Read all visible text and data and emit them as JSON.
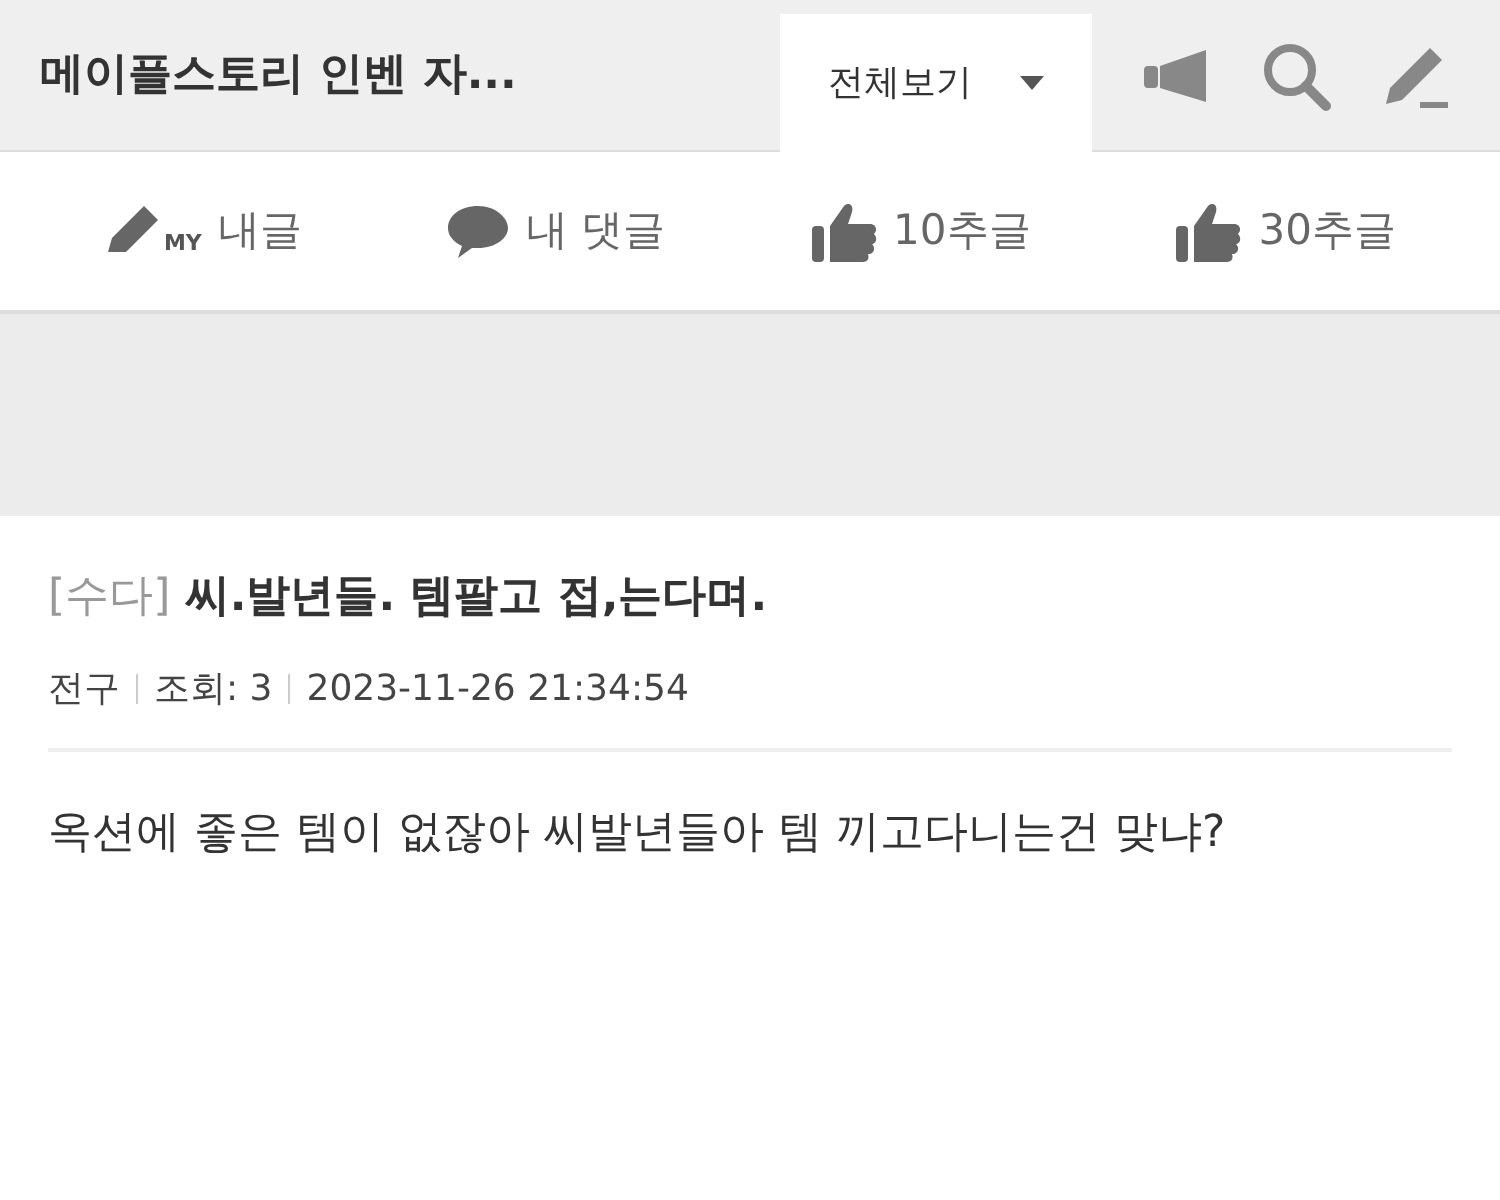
{
  "header": {
    "title": "메이플스토리 인벤 자...",
    "dropdown": "전체보기"
  },
  "nav": [
    {
      "kind": "my",
      "label": "내글",
      "badge": "MY"
    },
    {
      "kind": "comment",
      "label": "내 댓글"
    },
    {
      "kind": "thumb",
      "label": "10추글"
    },
    {
      "kind": "thumb",
      "label": "30추글"
    }
  ],
  "post": {
    "category": "[수다]",
    "title": "씨.발년들. 템팔고 접,는다며.",
    "author": "전구",
    "views": "조회: 3",
    "date": "2023-11-26 21:34:54",
    "body": "옥션에 좋은 템이 없잖아 씨발년들아 템 끼고다니는건 맞냐?"
  }
}
